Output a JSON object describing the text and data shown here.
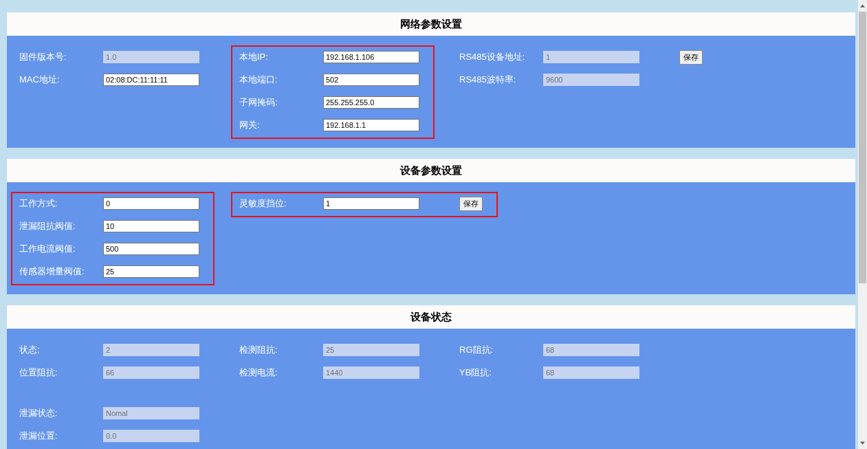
{
  "sections": [
    {
      "title": "网络参数设置",
      "bands": [
        {
          "groups": [
            {
              "highlighted": false,
              "rows": [
                {
                  "label": "固件版本号:",
                  "value": "1.0",
                  "disabled": true
                },
                {
                  "label": "MAC地址:",
                  "value": "02:08:DC:11:11:11",
                  "disabled": false
                }
              ]
            },
            {
              "highlighted": true,
              "rows": [
                {
                  "label": "本地IP:",
                  "value": "192.168.1.106",
                  "disabled": false
                },
                {
                  "label": "本地端口:",
                  "value": "502",
                  "disabled": false
                },
                {
                  "label": "子网掩码:",
                  "value": "255.255.255.0",
                  "disabled": false
                },
                {
                  "label": "网关:",
                  "value": "192.168.1.1",
                  "disabled": false
                }
              ]
            },
            {
              "highlighted": false,
              "button": "保存",
              "rows": [
                {
                  "label": "RS485设备地址:",
                  "value": "1",
                  "disabled": true
                },
                {
                  "label": "RS485波特率:",
                  "value": "9600",
                  "disabled": true
                }
              ]
            }
          ]
        }
      ]
    },
    {
      "title": "设备参数设置",
      "bands": [
        {
          "groups": [
            {
              "highlighted": true,
              "rows": [
                {
                  "label": "工作方式:",
                  "value": "0",
                  "disabled": false
                },
                {
                  "label": "泄漏阻抗阀值:",
                  "value": "10",
                  "disabled": false
                },
                {
                  "label": "工作电流阀值:",
                  "value": "500",
                  "disabled": false
                },
                {
                  "label": "传感器增量阀值:",
                  "value": "25",
                  "disabled": false
                }
              ]
            },
            {
              "highlighted": true,
              "button": "保存",
              "rows": [
                {
                  "label": "灵敏度挡位:",
                  "value": "1",
                  "disabled": false
                }
              ]
            }
          ]
        }
      ]
    },
    {
      "title": "设备状态",
      "bands": [
        {
          "groups": [
            {
              "highlighted": false,
              "rows": [
                {
                  "label": "状态:",
                  "value": "2",
                  "disabled": true
                },
                {
                  "label": "位置阻抗:",
                  "value": "66",
                  "disabled": true
                }
              ]
            },
            {
              "highlighted": false,
              "rows": [
                {
                  "label": "检测阻抗:",
                  "value": "25",
                  "disabled": true
                },
                {
                  "label": "检测电流:",
                  "value": "1440",
                  "disabled": true
                }
              ]
            },
            {
              "highlighted": false,
              "rows": [
                {
                  "label": "RG阻抗:",
                  "value": "68",
                  "disabled": true
                },
                {
                  "label": "YB阻抗:",
                  "value": "68",
                  "disabled": true
                }
              ]
            }
          ]
        },
        {
          "groups": [
            {
              "highlighted": false,
              "rows": [
                {
                  "label": "泄漏状态:",
                  "value": "Nomal",
                  "disabled": true
                },
                {
                  "label": "泄漏位置:",
                  "value": "0.0",
                  "disabled": true
                }
              ]
            }
          ]
        }
      ]
    }
  ]
}
